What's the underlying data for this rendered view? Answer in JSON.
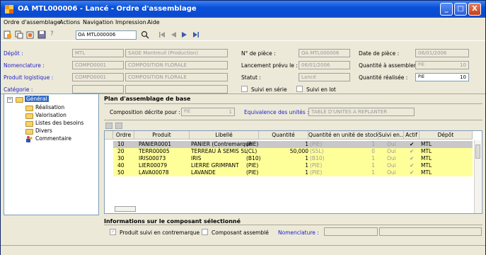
{
  "window": {
    "title": "OA MTL000006 - Lancé - Ordre d'assemblage",
    "minimize": "_",
    "maximize": "□",
    "close": "X"
  },
  "menu": [
    "Ordre d'assemblage",
    "Actions",
    "Navigation",
    "Impression",
    "Aide"
  ],
  "toolbar": {
    "document_value": "OA MTL000006",
    "help": "?"
  },
  "header": {
    "depot_label": "Dépôt :",
    "depot_code": "MTL",
    "depot_name": "SAGE Montreuil (Production)",
    "nomenclature_label": "Nomenclature :",
    "nomenclature_code": "COMPO0001",
    "nomenclature_name": "COMPOSITION FLORALE",
    "produit_label": "Produit logistique :",
    "produit_code": "COMPO0001",
    "produit_name": "COMPOSITION FLORALE",
    "categorie_label": "Catégorie :",
    "piece_label": "N° de pièce :",
    "piece_value": "OA MTL000006",
    "lancement_label": "Lancement prévu le :",
    "lancement_value": "06/01/2006",
    "statut_label": "Statut :",
    "statut_value": "Lancé",
    "suivi_serie": "Suivi en série",
    "suivi_lot": "Suivi en lot",
    "date_label": "Date de pièce :",
    "date_value": "06/01/2006",
    "qte_assembler_label": "Quantité à assembler :",
    "qte_assembler_unit": "PIE",
    "qte_assembler_value": "10",
    "qte_realisee_label": "Quantité réalisée :",
    "qte_realisee_unit": "PIE",
    "qte_realisee_value": "10"
  },
  "tree": {
    "root": "Général",
    "children": [
      "Réalisation",
      "Valorisation",
      "Listes des besoins",
      "Divers",
      "Commentaire"
    ]
  },
  "plan": {
    "title": "Plan d'assemblage de base",
    "composition_label": "Composition décrite pour :",
    "composition_unit": "PIE",
    "composition_value": "1",
    "equivalence_label": "Equivalence des unités :",
    "equivalence_value": "TABLE D'UNITES A REPLANTER"
  },
  "grid": {
    "columns": [
      "Ordre",
      "Produit",
      "Libellé",
      "Quantité",
      "Quantité en unité de stock",
      "Suivi en...",
      "Actif",
      "Dépôt"
    ],
    "rows": [
      {
        "ordre": "10",
        "produit": "PANIER0001",
        "libelle": "PANIER (Contremarque",
        "unit": "(PIE)",
        "qte": "1",
        "stock_unit": "(PIE)",
        "stock_qte": "1",
        "suivi": "Oui",
        "actif": "✔",
        "depot": "MTL"
      },
      {
        "ordre": "20",
        "produit": "TERR00005",
        "libelle": "TERREAU À SEMIS 5L",
        "unit": "(CL)",
        "qte": "50,000",
        "stock_unit": "(S5L)",
        "stock_qte": "0",
        "suivi": "Oui",
        "actif": "✔",
        "depot": "MTL"
      },
      {
        "ordre": "30",
        "produit": "IRIS00073",
        "libelle": "IRIS",
        "unit": "(B10)",
        "qte": "1",
        "stock_unit": "(B10)",
        "stock_qte": "1",
        "suivi": "Oui",
        "actif": "✔",
        "depot": "MTL"
      },
      {
        "ordre": "40",
        "produit": "LIER00079",
        "libelle": "LIERRE GRIMPANT",
        "unit": "(PIE)",
        "qte": "1",
        "stock_unit": "(PIE)",
        "stock_qte": "1",
        "suivi": "Oui",
        "actif": "✔",
        "depot": "MTL"
      },
      {
        "ordre": "50",
        "produit": "LAVA00078",
        "libelle": "LAVANDE",
        "unit": "(PIE)",
        "qte": "1",
        "stock_unit": "(PIE)",
        "stock_qte": "1",
        "suivi": "Oui",
        "actif": "✔",
        "depot": "MTL"
      }
    ]
  },
  "composant": {
    "title": "Informations sur le composant sélectionné",
    "suivi_contremarque": "Produit suivi en contremarque",
    "assemble": "Composant assemblé",
    "nomenclature_label": "Nomenclature :"
  },
  "colors": {
    "highlight_row": "#ffff99",
    "selected_row": "#c8c8c8",
    "link_blue": "#2222cc"
  }
}
